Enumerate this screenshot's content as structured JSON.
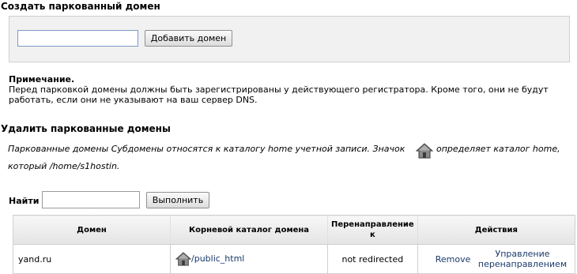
{
  "create_section": {
    "title": "Создать паркованный домен",
    "input_value": "",
    "input_placeholder": "",
    "add_button_label": "Добавить домен"
  },
  "note": {
    "heading": "Примечание.",
    "text": "Перед парковкой домены должны быть зарегистрированы у действующего регистратора. Кроме того, они не будут работать, если они не указывают на ваш сервер DNS."
  },
  "remove_section": {
    "title": "Удалить паркованные домены",
    "info_part1": "Паркованные домены Субдомены относятся к каталогу home учетной записи. Значок",
    "info_part2": "определяет каталог home,",
    "info_line2": "который /home/s1hostin."
  },
  "search": {
    "label": "Найти",
    "value": "",
    "button_label": "Выполнить"
  },
  "table": {
    "headers": {
      "domain": "Домен",
      "docroot": "Корневой каталог домена",
      "redirect": "Перенаправление к",
      "actions": "Действия"
    },
    "rows": [
      {
        "domain": "yand.ru",
        "docroot": "/public_html",
        "redirect": "not redirected",
        "remove": "Remove",
        "manage": "Управление перенаправлением"
      }
    ]
  },
  "icons": {
    "home": "home-icon"
  }
}
